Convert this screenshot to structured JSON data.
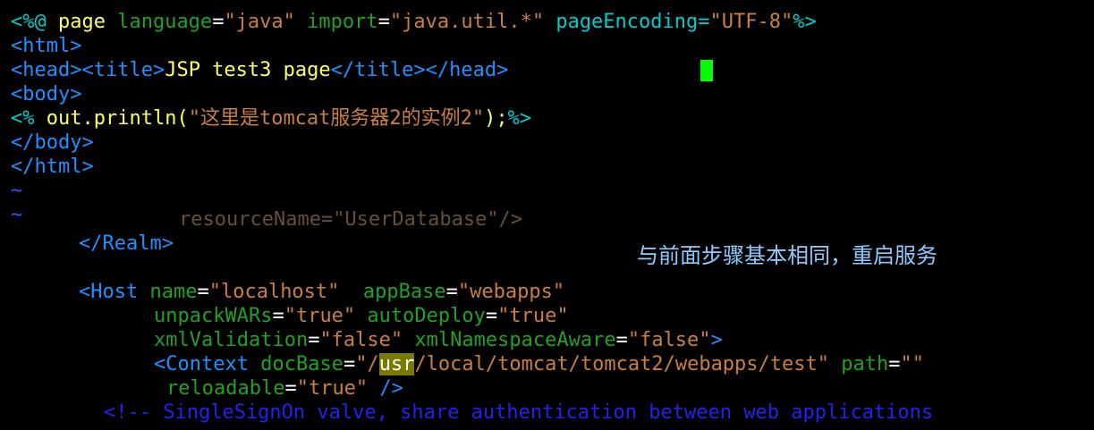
{
  "editor_top": {
    "line1": {
      "open": "<%@ ",
      "kw_page": "page",
      "attr_language": " language",
      "eq1": "=",
      "val_language": "\"java\"",
      "attr_import": " import",
      "eq2": "=",
      "val_import": "\"java.util.*\"",
      "attr_encoding": " pageEncoding",
      "eq3": "=",
      "val_encoding": "\"UTF-8\"",
      "close": "%>"
    },
    "line2": "<html>",
    "line3": {
      "head_open": "<head>",
      "title_open": "<title>",
      "title_text": "JSP test3 page",
      "title_close": "</title>",
      "head_close": "</head>"
    },
    "line4": "<body>",
    "line5": {
      "open": "<% ",
      "code": "out.println(",
      "string": "\"这里是tomcat服务器2的实例2\"",
      "end": ");",
      "close": "%>"
    },
    "line6": "</body>",
    "line7": "</html>",
    "tilde1": "~",
    "tilde2": "~"
  },
  "editor_bottom": {
    "clipped_line": "resourceName=\"UserDatabase\"/>",
    "realm_close": "</Realm>",
    "host_line": {
      "open": "<Host",
      "attr_name": " name",
      "val_name": "\"localhost\"",
      "attr_appbase": "  appBase",
      "val_appbase": "\"webapps\""
    },
    "host_line2": {
      "attr_unpack": "unpackWARs",
      "val_unpack": "\"true\"",
      "attr_autodeploy": " autoDeploy",
      "val_autodeploy": "\"true\""
    },
    "host_line3": {
      "attr_xmlval": "xmlValidation",
      "val_xmlval": "\"false\"",
      "attr_ns": " xmlNamespaceAware",
      "val_ns": "\"false\"",
      "close": ">"
    },
    "context_line": {
      "open": "<Context",
      "attr_docbase": " docBase",
      "val_pre": "\"/",
      "val_hl": "usr",
      "val_post": "/local/tomcat/tomcat2/webapps/test\"",
      "attr_path": " path",
      "val_path": "\"\""
    },
    "context_line2": {
      "attr_reload": "reloadable",
      "val_reload": "\"true\"",
      "close": " />"
    },
    "comment_line": "<!-- SingleSignOn valve, share authentication between web applications"
  },
  "annotation": {
    "note": "与前面步骤基本相同，重启服务"
  },
  "colors": {
    "background": "#000000",
    "cursor": "#00ff00",
    "tag": "#1e90ff",
    "attribute": "#22a022",
    "value": "#c87f3f",
    "text": "#ffff66",
    "tilde": "#3355ff",
    "comment": "#2222ee",
    "search_highlight": "#7a7a00",
    "note": "#8ecbff"
  }
}
